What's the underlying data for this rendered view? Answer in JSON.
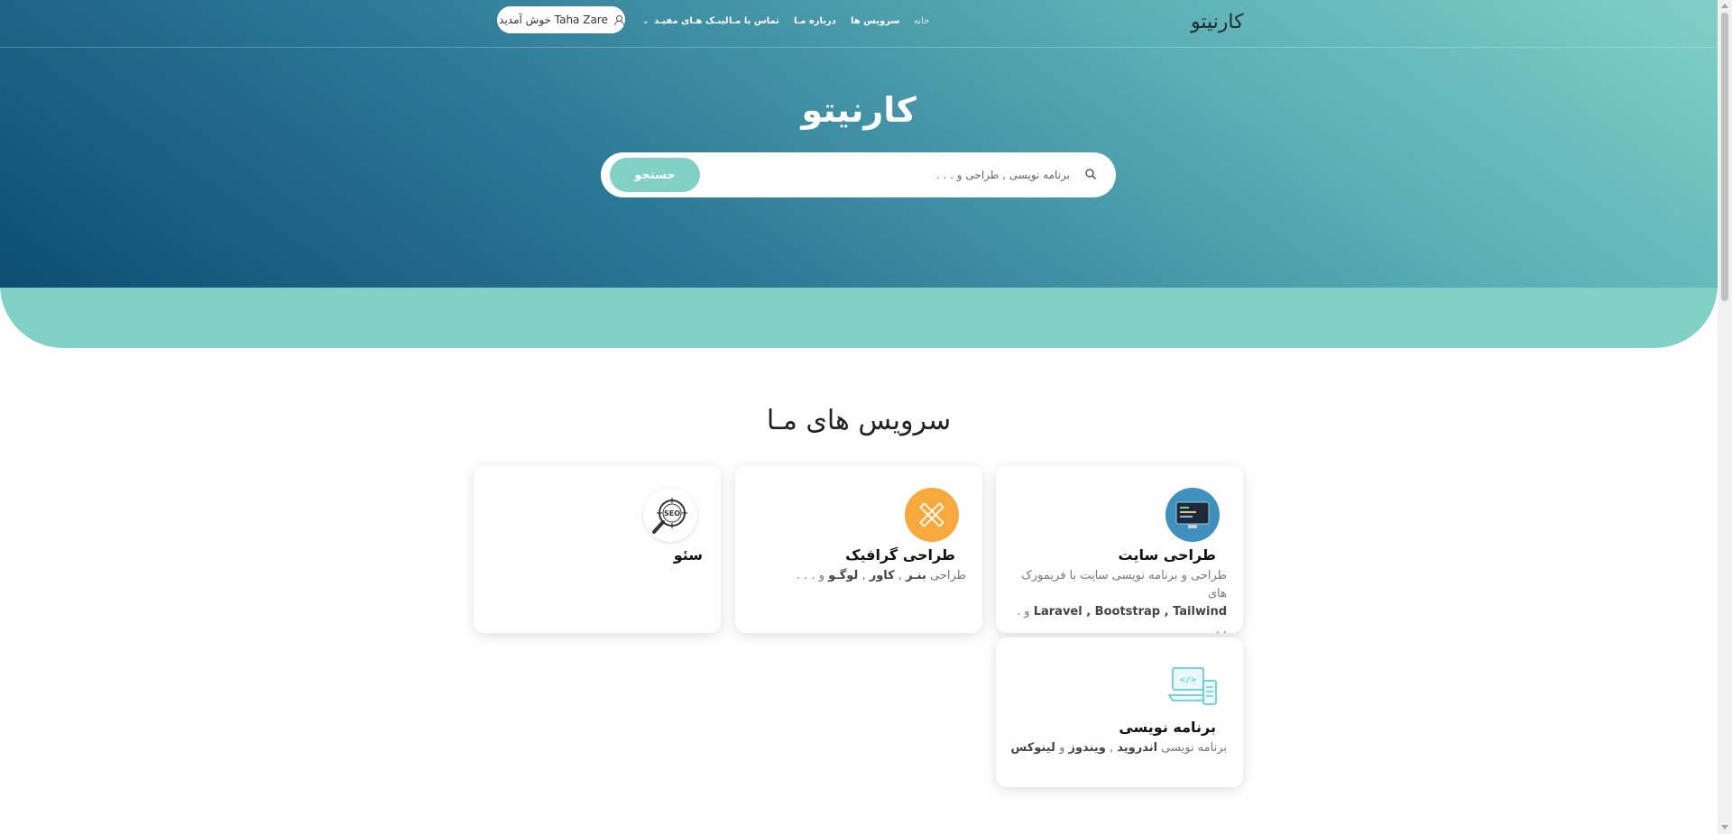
{
  "header": {
    "brand": "کارنیتو",
    "nav": [
      {
        "id": "home",
        "label": "خانه"
      },
      {
        "id": "services",
        "label": "سرویس ها"
      },
      {
        "id": "about",
        "label": "درباره مـا"
      },
      {
        "id": "contact",
        "label": "تماس با مـا"
      },
      {
        "id": "links",
        "label": "لینـک هـای مفیـد"
      }
    ],
    "user_greeting": "Taha Zare خوش آمدید"
  },
  "hero": {
    "title": "کارنیتو",
    "search_placeholder": "برنامه نویسی , طراحی و . . .",
    "search_button": "جستجو"
  },
  "services": {
    "title": "سرویس های مـا",
    "cards": [
      {
        "title": "طراحی سایت",
        "desc_line1": "طراحی و برنامه نویسی سایت با فریمورک های",
        "desc_line2_bold": "Laravel , Bootstrap , Tailwind",
        "desc_line2_tail": " و . . .",
        "icon": "code-monitor-icon",
        "icon_color": "#3f8fbf"
      },
      {
        "title": "طراحی گرافیک",
        "desc_pre": "طراحی ",
        "desc_b1": "بنـر",
        "desc_sep1": " , ",
        "desc_b2": "کاور",
        "desc_sep2": " , ",
        "desc_b3": "لوگـو",
        "desc_tail": " و . . .",
        "icon": "pencil-ruler-icon",
        "icon_color": "#f7a93b"
      },
      {
        "title": "سئو",
        "icon": "seo-magnifier-icon",
        "icon_text": "SEO"
      },
      {
        "title": "برنامه نویسی",
        "desc_pre": "برنامه نویسی ",
        "desc_b1": "اندروید",
        "desc_sep1": " , ",
        "desc_b2": "ویندوز",
        "desc_sep2": " و ",
        "desc_b3": "لینوکس",
        "icon": "code-devices-icon",
        "icon_color": "#4fc3d6"
      }
    ]
  },
  "colors": {
    "accent": "#80d0c6",
    "hero_dark": "#0f4d74",
    "hero_mid": "#2b7796"
  }
}
